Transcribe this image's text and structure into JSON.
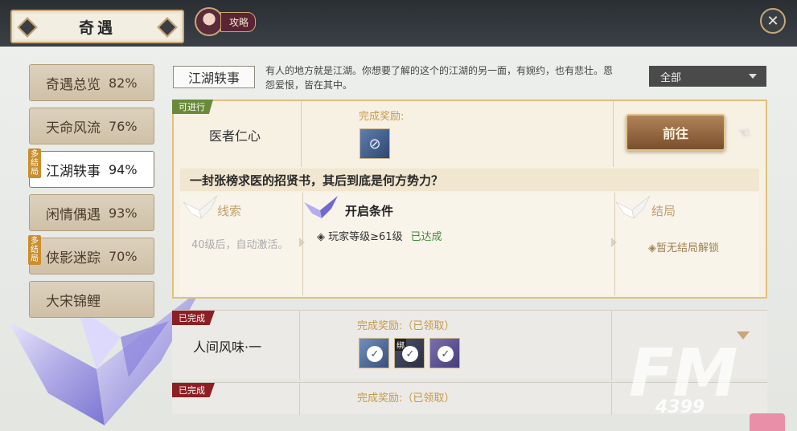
{
  "header": {
    "title": "奇遇",
    "guide_label": "攻略",
    "close_symbol": "✕"
  },
  "sidebar": {
    "items": [
      {
        "label": "奇遇总览",
        "pct": "82%",
        "multi": ""
      },
      {
        "label": "天命风流",
        "pct": "76%",
        "multi": ""
      },
      {
        "label": "江湖轶事",
        "pct": "94%",
        "multi": "多结局"
      },
      {
        "label": "闲情偶遇",
        "pct": "93%",
        "multi": ""
      },
      {
        "label": "侠影迷踪",
        "pct": "70%",
        "multi": "多结局"
      },
      {
        "label": "大宋锦鲤",
        "pct": "",
        "multi": ""
      }
    ],
    "active_index": 2
  },
  "main": {
    "category_tab": "江湖轶事",
    "description": "有人的地方就是江湖。你想要了解的这个的江湖的另一面，有婉约，也有悲壮。恩怨爱恨，皆在其中。",
    "filter": {
      "selected": "全部"
    }
  },
  "open_card": {
    "status": "可进行",
    "name": "医者仁心",
    "reward_label": "完成奖励:",
    "goto_label": "前往",
    "story": "一封张榜求医的招贤书，其后到底是何方势力？",
    "clue_title": "线索",
    "clue_text": "40级后，自动激活。",
    "condition_title": "开启条件",
    "condition_text": "玩家等级≥61级",
    "condition_status": "已达成",
    "ending_title": "结局",
    "ending_text": "暂无结局解锁"
  },
  "done_cards": [
    {
      "status": "已完成",
      "name": "人间风味·一",
      "reward_label": "完成奖励:（已领取）",
      "bind_label": "绑"
    },
    {
      "status": "已完成",
      "name": "",
      "reward_label": "完成奖励:（已领取）"
    }
  ],
  "watermark": {
    "main": "FM",
    "sub": "4399"
  },
  "colors": {
    "accent_gold": "#c9a777",
    "done_red": "#8c1f24",
    "open_green": "#6a8a3a",
    "ok_green": "#3f8a3a"
  }
}
